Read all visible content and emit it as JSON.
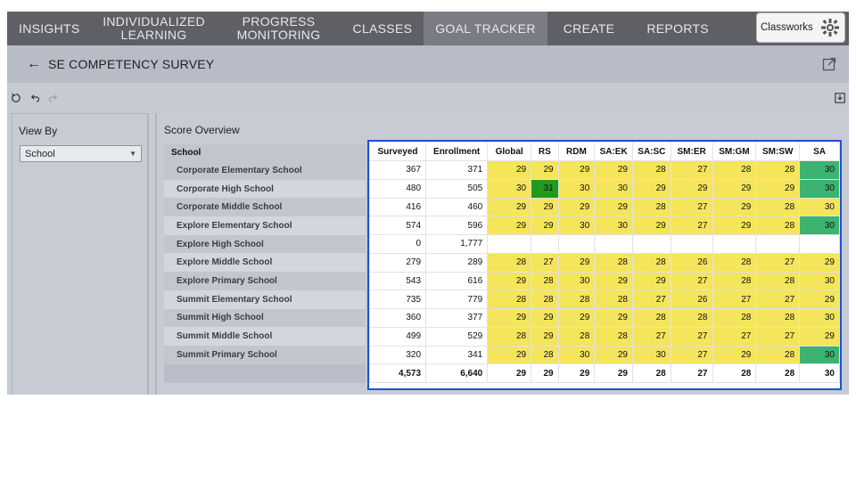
{
  "nav": {
    "items": [
      "INSIGHTS",
      "INDIVIDUALIZED LEARNING",
      "PROGRESS MONITORING",
      "CLASSES",
      "GOAL TRACKER",
      "CREATE",
      "REPORTS"
    ],
    "brand": "Classworks",
    "active": "GOAL TRACKER"
  },
  "page": {
    "title": "SE COMPETENCY SURVEY"
  },
  "left_panel": {
    "title": "View By",
    "select_value": "School"
  },
  "overview": {
    "title": "Score Overview",
    "school_header": "School",
    "columns": [
      "Surveyed",
      "Enrollment",
      "Global",
      "RS",
      "RDM",
      "SA:EK",
      "SA:SC",
      "SM:ER",
      "SM:GM",
      "SM:SW",
      "SA"
    ],
    "rows": [
      {
        "school": "Corporate Elementary School",
        "cells": [
          "367",
          "371",
          "29",
          "29",
          "29",
          "29",
          "28",
          "27",
          "28",
          "28",
          "30"
        ],
        "colors": [
          "",
          "",
          "y",
          "y",
          "y",
          "y",
          "y",
          "y",
          "y",
          "y",
          "g"
        ]
      },
      {
        "school": "Corporate High School",
        "cells": [
          "480",
          "505",
          "30",
          "31",
          "30",
          "30",
          "29",
          "29",
          "29",
          "29",
          "30"
        ],
        "colors": [
          "",
          "",
          "y",
          "dg",
          "y",
          "y",
          "y",
          "y",
          "y",
          "y",
          "g"
        ]
      },
      {
        "school": "Corporate Middle School",
        "cells": [
          "416",
          "460",
          "29",
          "29",
          "29",
          "29",
          "28",
          "27",
          "29",
          "28",
          "30"
        ],
        "colors": [
          "",
          "",
          "y",
          "y",
          "y",
          "y",
          "y",
          "y",
          "y",
          "y",
          "y"
        ]
      },
      {
        "school": "Explore Elementary School",
        "cells": [
          "574",
          "596",
          "29",
          "29",
          "30",
          "30",
          "29",
          "27",
          "29",
          "28",
          "30"
        ],
        "colors": [
          "",
          "",
          "y",
          "y",
          "y",
          "y",
          "y",
          "y",
          "y",
          "y",
          "g"
        ]
      },
      {
        "school": "Explore High School",
        "cells": [
          "0",
          "1,777",
          "",
          "",
          "",
          "",
          "",
          "",
          "",
          "",
          ""
        ],
        "colors": [
          "",
          "",
          "",
          "",
          "",
          "",
          "",
          "",
          "",
          "",
          ""
        ]
      },
      {
        "school": "Explore Middle School",
        "cells": [
          "279",
          "289",
          "28",
          "27",
          "29",
          "28",
          "28",
          "26",
          "28",
          "27",
          "29"
        ],
        "colors": [
          "",
          "",
          "y",
          "y",
          "y",
          "y",
          "y",
          "y",
          "y",
          "y",
          "y"
        ]
      },
      {
        "school": "Explore Primary School",
        "cells": [
          "543",
          "616",
          "29",
          "28",
          "30",
          "29",
          "29",
          "27",
          "28",
          "28",
          "30"
        ],
        "colors": [
          "",
          "",
          "y",
          "y",
          "y",
          "y",
          "y",
          "y",
          "y",
          "y",
          "y"
        ]
      },
      {
        "school": "Summit Elementary School",
        "cells": [
          "735",
          "779",
          "28",
          "28",
          "28",
          "28",
          "27",
          "26",
          "27",
          "27",
          "29"
        ],
        "colors": [
          "",
          "",
          "y",
          "y",
          "y",
          "y",
          "y",
          "y",
          "y",
          "y",
          "y"
        ]
      },
      {
        "school": "Summit High School",
        "cells": [
          "360",
          "377",
          "29",
          "29",
          "29",
          "29",
          "28",
          "28",
          "28",
          "28",
          "30"
        ],
        "colors": [
          "",
          "",
          "y",
          "y",
          "y",
          "y",
          "y",
          "y",
          "y",
          "y",
          "y"
        ]
      },
      {
        "school": "Summit Middle School",
        "cells": [
          "499",
          "529",
          "28",
          "29",
          "28",
          "28",
          "27",
          "27",
          "27",
          "27",
          "29"
        ],
        "colors": [
          "",
          "",
          "y",
          "y",
          "y",
          "y",
          "y",
          "y",
          "y",
          "y",
          "y"
        ]
      },
      {
        "school": "Summit Primary School",
        "cells": [
          "320",
          "341",
          "29",
          "28",
          "30",
          "29",
          "30",
          "27",
          "29",
          "28",
          "30"
        ],
        "colors": [
          "",
          "",
          "y",
          "y",
          "y",
          "y",
          "y",
          "y",
          "y",
          "y",
          "g"
        ]
      }
    ],
    "totals": [
      "4,573",
      "6,640",
      "29",
      "29",
      "29",
      "29",
      "28",
      "27",
      "28",
      "28",
      "30"
    ]
  },
  "colors": {
    "nav_bg": "#5f6066",
    "highlight_border": "#1f54d1",
    "mid_score": "#f4e55b",
    "high_score": "#3cb371",
    "top_score": "#229a1f"
  },
  "icons": [
    "arrow-left-icon",
    "open-external-icon",
    "reset-icon",
    "undo-icon",
    "redo-icon",
    "download-icon",
    "classworks-logo-icon",
    "dropdown-caret-icon"
  ]
}
